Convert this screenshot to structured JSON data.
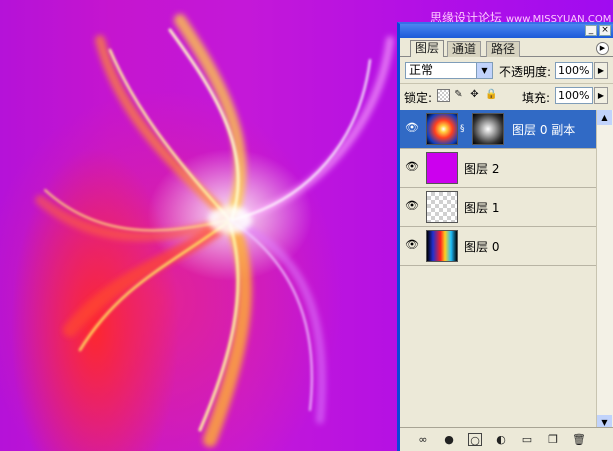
{
  "watermark": {
    "cn": "思缘设计论坛",
    "en": "www.MISSYUAN.COM"
  },
  "panel": {
    "title_buttons": [
      "_",
      "×"
    ],
    "tabs": [
      {
        "label": "图层",
        "active": true
      },
      {
        "label": "通道",
        "active": false
      },
      {
        "label": "路径",
        "active": false
      }
    ],
    "blend_mode": "正常",
    "opacity_label": "不透明度:",
    "opacity_value": "100%",
    "lock_label": "锁定:",
    "fill_label": "填充:",
    "fill_value": "100%",
    "layers": [
      {
        "name": "图层 0 副本",
        "selected": true,
        "thumb": "swirl-color",
        "mask": true
      },
      {
        "name": "图层 2",
        "selected": false,
        "thumb": "solid-magenta",
        "mask": false
      },
      {
        "name": "图层 1",
        "selected": false,
        "thumb": "transparent",
        "mask": false
      },
      {
        "name": "图层 0",
        "selected": false,
        "thumb": "rainbow",
        "mask": false
      }
    ],
    "bottom_icons": [
      "link-icon",
      "layer-style-icon",
      "add-mask-icon",
      "adjustment-layer-icon",
      "new-group-icon",
      "new-layer-icon",
      "trash-icon"
    ]
  },
  "colors": {
    "accent": "#316ac5",
    "canvas": "#b512d8"
  }
}
